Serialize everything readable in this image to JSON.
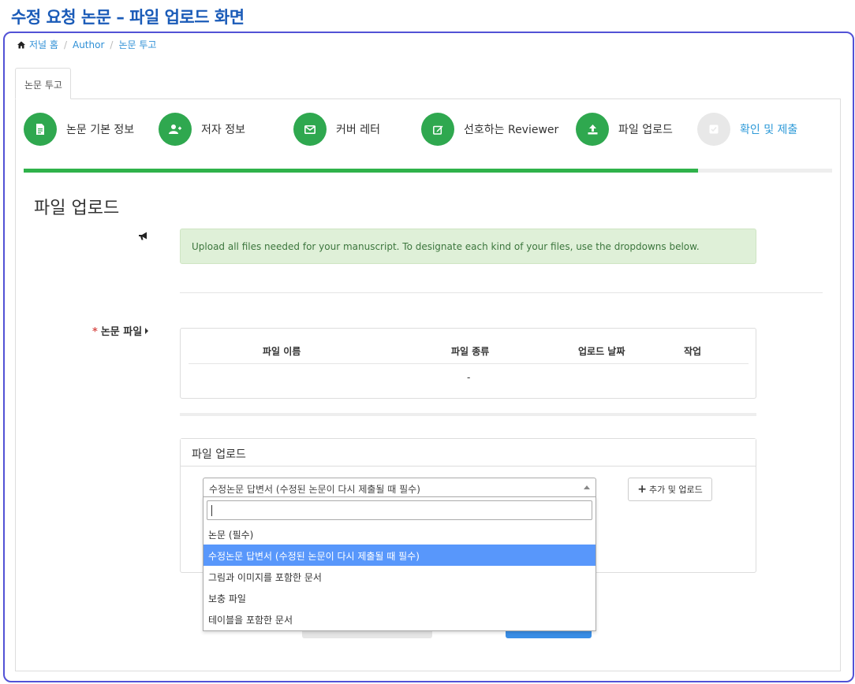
{
  "page_heading": "수정 요청 논문 – 파일 업로드 화면",
  "breadcrumb": {
    "items": [
      "저널 홈",
      "Author",
      "논문 투고"
    ]
  },
  "tab": {
    "label": "논문 투고"
  },
  "steps": [
    {
      "label": "논문 기본 정보",
      "icon": "document-icon",
      "status": "done"
    },
    {
      "label": "저자 정보",
      "icon": "user-plus-icon",
      "status": "done"
    },
    {
      "label": "커버 레터",
      "icon": "envelope-icon",
      "status": "done"
    },
    {
      "label": "선호하는 Reviewer",
      "icon": "edit-icon",
      "status": "done"
    },
    {
      "label": "파일 업로드",
      "icon": "upload-icon",
      "status": "current"
    },
    {
      "label": "확인 및 제출",
      "icon": "check-icon",
      "status": "pending"
    }
  ],
  "progress": {
    "percent": 83.4,
    "color": "#2fb24a"
  },
  "section": {
    "title": "파일 업로드",
    "alert": "Upload all files needed for your manuscript. To designate each kind of your files, use the dropdowns below."
  },
  "paper_files": {
    "label": "논문 파일",
    "required_marker": "*",
    "columns": [
      "파일 이름",
      "파일 종류",
      "업로드 날짜",
      "작업"
    ],
    "empty_value": "-"
  },
  "upload": {
    "panel_title": "파일 업로드",
    "selected_type": "수정논문 답변서 (수정된 논문이 다시 제출될 때 필수)",
    "search_value": "",
    "options": [
      "논문 (필수)",
      "수정논문 답변서 (수정된 논문이 다시 제출될 때 필수)",
      "그림과 이미지를 포함한 문서",
      "보충 파일",
      "테이블을 포함한 문서"
    ],
    "selected_index": 1,
    "add_button_label": "추가 및 업로드"
  },
  "colors": {
    "accent": "#2fa84f",
    "link": "#2e8fd6",
    "heading": "#1a5bb8",
    "option_highlight": "#5897fb"
  }
}
